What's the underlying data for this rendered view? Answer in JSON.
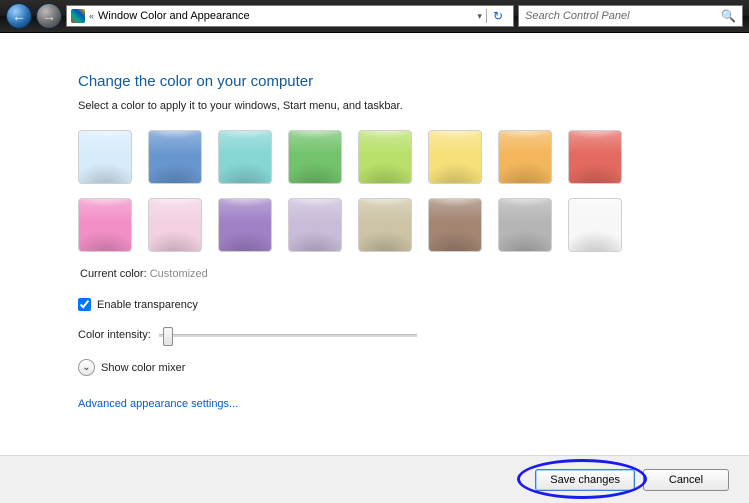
{
  "nav": {
    "breadcrumb": "Window Color and Appearance",
    "search_placeholder": "Search Control Panel"
  },
  "heading": "Change the color on your computer",
  "subtitle": "Select a color to apply it to your windows, Start menu, and taskbar.",
  "colors": [
    {
      "name": "sky",
      "hex": "#d7ecfb"
    },
    {
      "name": "twilight",
      "hex": "#6897d0"
    },
    {
      "name": "sea",
      "hex": "#86d6d6"
    },
    {
      "name": "leaf",
      "hex": "#72c36c"
    },
    {
      "name": "lime",
      "hex": "#b9e06a"
    },
    {
      "name": "sun",
      "hex": "#f7e07a"
    },
    {
      "name": "pumpkin",
      "hex": "#f3b65b"
    },
    {
      "name": "ruby",
      "hex": "#e46a60"
    },
    {
      "name": "fuchsia",
      "hex": "#f28fc6"
    },
    {
      "name": "blush",
      "hex": "#f3d1e3"
    },
    {
      "name": "violet",
      "hex": "#a081c6"
    },
    {
      "name": "lavender",
      "hex": "#c9bcda"
    },
    {
      "name": "taupe",
      "hex": "#cdc4a5"
    },
    {
      "name": "chocolate",
      "hex": "#a38572"
    },
    {
      "name": "slate",
      "hex": "#b5b5b5"
    },
    {
      "name": "frost",
      "hex": "#f7f7f7"
    }
  ],
  "current_color_label": "Current color:",
  "current_color_value": "Customized",
  "transparency_label": "Enable transparency",
  "transparency_checked": true,
  "intensity_label": "Color intensity:",
  "mixer_label": "Show color mixer",
  "advanced_link": "Advanced appearance settings...",
  "buttons": {
    "save": "Save changes",
    "cancel": "Cancel"
  }
}
